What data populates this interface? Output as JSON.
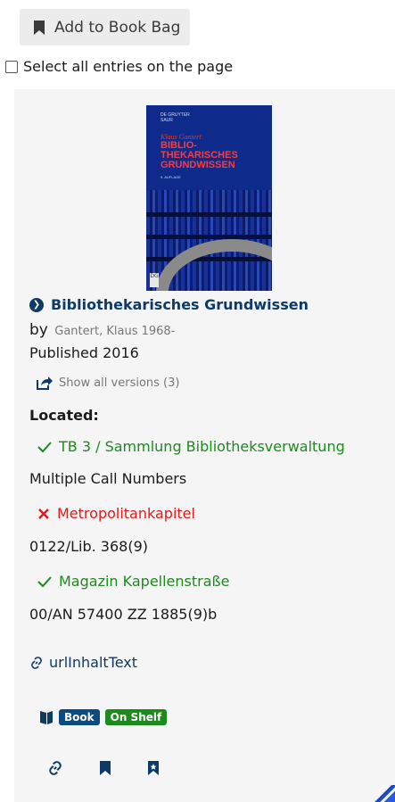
{
  "toolbar": {
    "add_to_bag_label": "Add to Book Bag",
    "select_all_label": "Select all entries on the page"
  },
  "record": {
    "cover": {
      "publisher": "DE GRUYTER\nSAUR",
      "author": "Klaus Gantert",
      "title": "BIBLIO-\nTHEKARISCHES\nGRUNDWISSEN",
      "edition": "9. AUFLAGE",
      "logo": "DG"
    },
    "title": "Bibliothekarisches Grundwissen",
    "by_label": "by",
    "author": "Gantert, Klaus 1968-",
    "published": "Published 2016",
    "versions_label": "Show all versions (3)",
    "located_label": "Located:",
    "locations": [
      {
        "status": "available",
        "name": "TB 3 / Sammlung Bibliotheksverwaltung",
        "call_number": "Multiple Call Numbers"
      },
      {
        "status": "unavailable",
        "name": "Metropolitankapitel",
        "call_number": "0122/Lib. 368(9)"
      },
      {
        "status": "available",
        "name": "Magazin Kapellenstraße",
        "call_number": "00/AN 57400 ZZ 1885(9)b"
      }
    ],
    "url_label": "urlInhaltText",
    "format_badge": "Book",
    "status_badge": "On Shelf"
  },
  "colors": {
    "link_blue": "#0d3b66",
    "available_green": "#1d8a1d",
    "unavailable_red": "#e11a1a",
    "record_bg": "#f5f5f5"
  },
  "icons": {
    "add_to_bag": "bookmark-icon",
    "title": "chevron-circle-right-icon",
    "versions": "share-arrow-icon",
    "available": "check-icon",
    "unavailable": "x-icon",
    "url": "link-icon",
    "format": "book-icon",
    "actions": [
      "link-icon",
      "bookmark-icon",
      "bookmark-star-icon"
    ]
  }
}
